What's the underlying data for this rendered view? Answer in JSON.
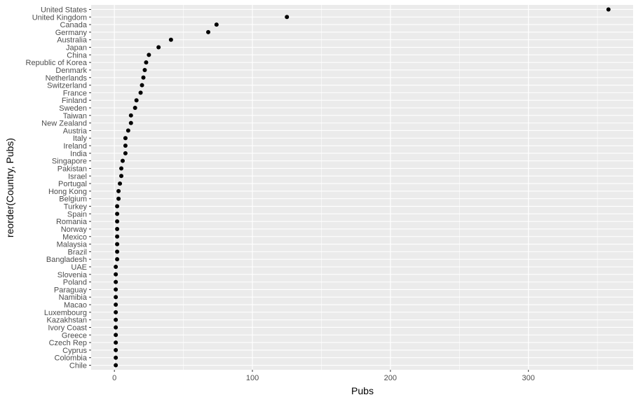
{
  "chart_data": {
    "type": "scatter",
    "title": "",
    "xlabel": "Pubs",
    "ylabel": "reorder(Country, Pubs)",
    "xlim": [
      -16.85,
      375.85
    ],
    "x_ticks": [
      0,
      100,
      200,
      300
    ],
    "x_tick_labels": [
      "0",
      "100",
      "200",
      "300"
    ],
    "x_minor_ticks": [
      50,
      150,
      250,
      350
    ],
    "grid": true,
    "legend": "none",
    "colors": {
      "panel": "#ebebeb",
      "grid": "#ffffff",
      "point": "#000000",
      "tick_text": "#4d4d4d",
      "tick": "#333333"
    },
    "points": [
      {
        "category": "United States",
        "value": 358
      },
      {
        "category": "United Kingdom",
        "value": 125
      },
      {
        "category": "Canada",
        "value": 74
      },
      {
        "category": "Germany",
        "value": 68
      },
      {
        "category": "Australia",
        "value": 41
      },
      {
        "category": "Japan",
        "value": 32
      },
      {
        "category": "China",
        "value": 25
      },
      {
        "category": "Republic of Korea",
        "value": 23
      },
      {
        "category": "Denmark",
        "value": 22
      },
      {
        "category": "Netherlands",
        "value": 21
      },
      {
        "category": "Switzerland",
        "value": 20
      },
      {
        "category": "France",
        "value": 19
      },
      {
        "category": "Finland",
        "value": 16
      },
      {
        "category": "Sweden",
        "value": 15
      },
      {
        "category": "Taiwan",
        "value": 12
      },
      {
        "category": "New Zealand",
        "value": 12
      },
      {
        "category": "Austria",
        "value": 10
      },
      {
        "category": "Italy",
        "value": 8
      },
      {
        "category": "Ireland",
        "value": 8
      },
      {
        "category": "India",
        "value": 8
      },
      {
        "category": "Singapore",
        "value": 6
      },
      {
        "category": "Pakistan",
        "value": 5
      },
      {
        "category": "Israel",
        "value": 5
      },
      {
        "category": "Portugal",
        "value": 4
      },
      {
        "category": "Hong Kong",
        "value": 3
      },
      {
        "category": "Belgium",
        "value": 3
      },
      {
        "category": "Turkey",
        "value": 2
      },
      {
        "category": "Spain",
        "value": 2
      },
      {
        "category": "Romania",
        "value": 2
      },
      {
        "category": "Norway",
        "value": 2
      },
      {
        "category": "Mexico",
        "value": 2
      },
      {
        "category": "Malaysia",
        "value": 2
      },
      {
        "category": "Brazil",
        "value": 2
      },
      {
        "category": "Bangladesh",
        "value": 2
      },
      {
        "category": "UAE",
        "value": 1
      },
      {
        "category": "Slovenia",
        "value": 1
      },
      {
        "category": "Poland",
        "value": 1
      },
      {
        "category": "Paraguay",
        "value": 1
      },
      {
        "category": "Namibia",
        "value": 1
      },
      {
        "category": "Macao",
        "value": 1
      },
      {
        "category": "Luxembourg",
        "value": 1
      },
      {
        "category": "Kazakhstan",
        "value": 1
      },
      {
        "category": "Ivory Coast",
        "value": 1
      },
      {
        "category": "Greece",
        "value": 1
      },
      {
        "category": "Czech Rep",
        "value": 1
      },
      {
        "category": "Cyprus",
        "value": 1
      },
      {
        "category": "Colombia",
        "value": 1
      },
      {
        "category": "Chile",
        "value": 1
      }
    ]
  }
}
